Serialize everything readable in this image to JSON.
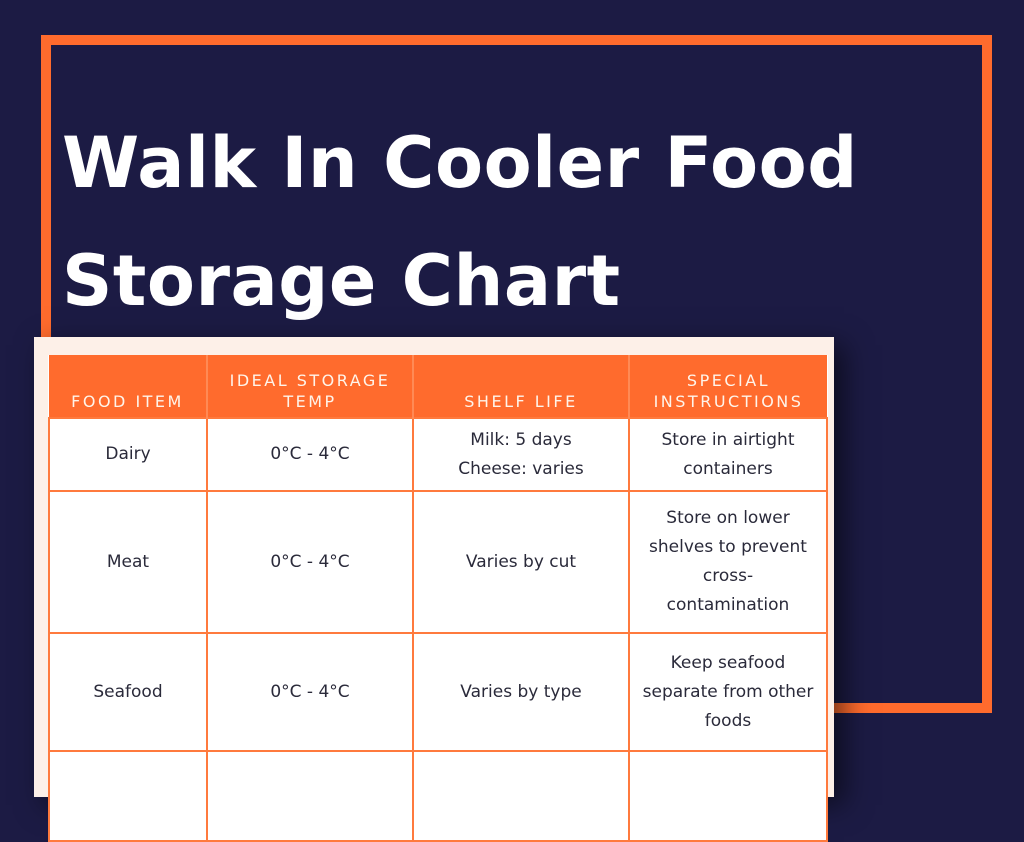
{
  "page": {
    "title": "Walk In Cooler Food Storage Chart",
    "colors": {
      "background": "#1c1b44",
      "accent": "#ff6b2d",
      "card": "#fdf0e8",
      "title_text": "#ffffff",
      "cell_text": "#2a2a3a"
    }
  },
  "table": {
    "headers": [
      "FOOD ITEM",
      "IDEAL STORAGE TEMP",
      "SHELF LIFE",
      "SPECIAL INSTRUCTIONS"
    ],
    "rows": [
      {
        "food_item": "Dairy",
        "temp": "0°C - 4°C",
        "shelf_life": [
          "Milk: 5 days",
          "Cheese: varies"
        ],
        "instructions": "Store in airtight containers"
      },
      {
        "food_item": "Meat",
        "temp": "0°C - 4°C",
        "shelf_life": [
          "Varies by cut"
        ],
        "instructions": "Store on lower shelves to prevent cross-contamination"
      },
      {
        "food_item": "Seafood",
        "temp": "0°C - 4°C",
        "shelf_life": [
          "Varies by type"
        ],
        "instructions": "Keep seafood separate from other foods"
      }
    ]
  }
}
